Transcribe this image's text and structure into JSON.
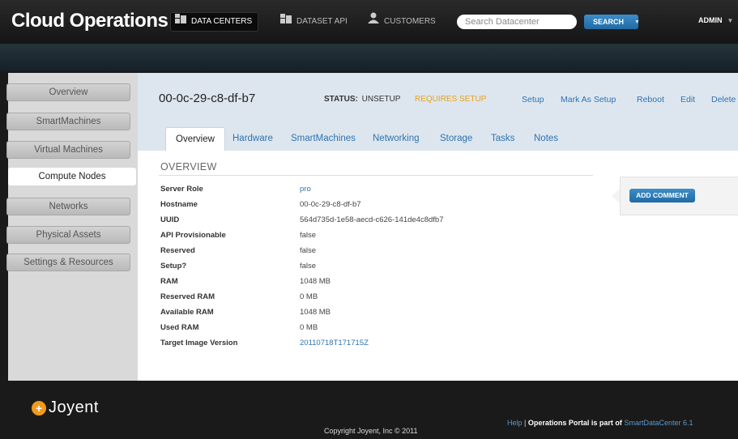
{
  "app": {
    "brand": "Cloud Operations",
    "nav": [
      {
        "label": "DATA CENTERS",
        "icon": "datacenter-icon"
      },
      {
        "label": "DATASET API",
        "icon": "dataset-icon"
      },
      {
        "label": "CUSTOMERS",
        "icon": "user-icon"
      }
    ],
    "search_placeholder": "Search Datacenter",
    "search_button": "SEARCH",
    "admin_label": "ADMIN"
  },
  "sidebar": {
    "items": [
      {
        "label": "Overview"
      },
      {
        "label": "SmartMachines"
      },
      {
        "label": "Virtual Machines"
      },
      {
        "label": "Compute Nodes",
        "active": true
      },
      {
        "label": "Networks"
      },
      {
        "label": "Physical Assets"
      },
      {
        "label": "Settings & Resources"
      }
    ]
  },
  "node": {
    "id": "00-0c-29-c8-df-b7",
    "status_label": "STATUS:",
    "status_value": "UNSETUP",
    "requires_setup": "REQUIRES SETUP",
    "actions": [
      "Setup",
      "Mark As Setup",
      "Reboot",
      "Edit",
      "Delete"
    ]
  },
  "tabs": [
    "Overview",
    "Hardware",
    "SmartMachines",
    "Networking",
    "Storage",
    "Tasks",
    "Notes"
  ],
  "overview": {
    "title": "OVERVIEW",
    "rows": [
      {
        "key": "Server Role",
        "value": "pro"
      },
      {
        "key": "Hostname",
        "value": "00-0c-29-c8-df-b7"
      },
      {
        "key": "UUID",
        "value": "564d735d-1e58-aecd-c626-141de4c8dfb7"
      },
      {
        "key": "API Provisionable",
        "value": "false"
      },
      {
        "key": "Reserved",
        "value": "false"
      },
      {
        "key": "Setup?",
        "value": "false"
      },
      {
        "key": "RAM",
        "value": "1048 MB"
      },
      {
        "key": "Reserved RAM",
        "value": "0 MB"
      },
      {
        "key": "Available RAM",
        "value": "1048 MB"
      },
      {
        "key": "Used RAM",
        "value": "0 MB"
      },
      {
        "key": "Target Image Version",
        "value": "20110718T171715Z"
      }
    ]
  },
  "comments": {
    "button": "ADD COMMENT"
  },
  "footer": {
    "logo_text": "Joyent",
    "copyright": "Copyright Joyent, Inc © 2011",
    "help": "Help",
    "separator": "|",
    "portal_text": "Operations Portal is part of",
    "product": "SmartDataCenter 6.1"
  },
  "colors": {
    "accent": "#2f73b0",
    "warning": "#e7a21b",
    "brand_orange": "#f29a1b"
  }
}
